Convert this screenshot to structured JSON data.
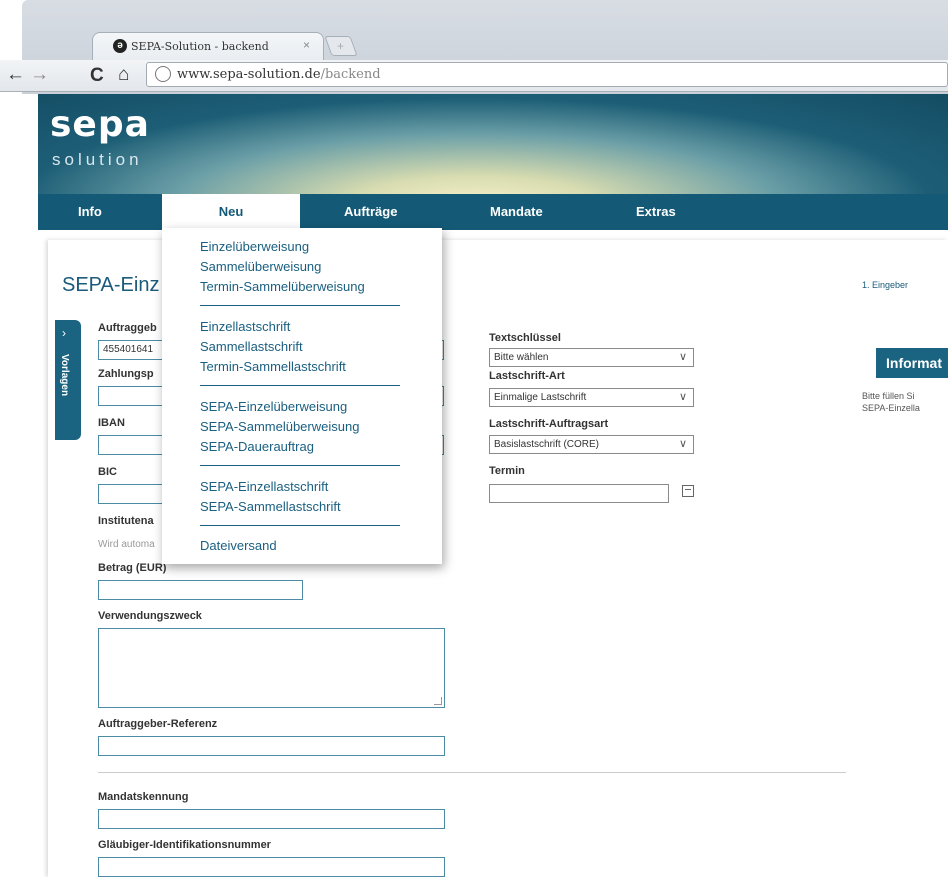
{
  "browser": {
    "tab_title": "SEPA-Solution - backend",
    "tab_close": "×",
    "new_tab": "+",
    "url_domain": "www.sepa-solution.de",
    "url_path": "/backend",
    "back": "←",
    "forward": "→",
    "reload": "C",
    "home": "⌂"
  },
  "logo": {
    "name": "sepa",
    "subtitle": "solution"
  },
  "nav": {
    "items": [
      "Info",
      "Neu",
      "Aufträge",
      "Mandate",
      "Extras"
    ],
    "active": "Neu"
  },
  "dropdown": {
    "items": [
      "Einzelüberweisung",
      "Sammelüberweisung",
      "Termin-Sammelüberweisung",
      "Einzellastschrift",
      "Sammellastschrift",
      "Termin-Sammellastschrift",
      "SEPA-Einzelüberweisung",
      "SEPA-Sammelüberweisung",
      "SEPA-Dauerauftrag",
      "SEPA-Einzellastschrift",
      "SEPA-Sammellastschrift",
      "Dateiversand"
    ]
  },
  "page": {
    "title": "SEPA-Einz",
    "step": "1. Eingeber",
    "side_tab": "Vorlagen",
    "side_arrow": "›"
  },
  "form": {
    "auftraggeber_label": "Auftraggeb",
    "auftraggeber_value": "455401641",
    "zahlungspflichtiger_label": "Zahlungsp",
    "iban_label": "IBAN",
    "bic_label": "BIC",
    "institut_label": "Institutena",
    "institut_hint": "Wird automa",
    "betrag_label": "Betrag (EUR)",
    "verwendungszweck_label": "Verwendungszweck",
    "referenz_label": "Auftraggeber-Referenz",
    "mandat_label": "Mandatskennung",
    "glaeubiger_label": "Gläubiger-Identifikationsnummer",
    "textschluessel_label": "Textschlüssel",
    "textschluessel_value": "Bitte wählen",
    "lastschriftart_label": "Lastschrift-Art",
    "lastschriftart_value": "Einmalige Lastschrift",
    "auftragsart_label": "Lastschrift-Auftragsart",
    "auftragsart_value": "Basislastschrift (CORE)",
    "termin_label": "Termin",
    "select_arrow": "∨"
  },
  "info": {
    "title": "Informat",
    "text_line1": "Bitte füllen Si",
    "text_line2": "SEPA-Einzella"
  }
}
